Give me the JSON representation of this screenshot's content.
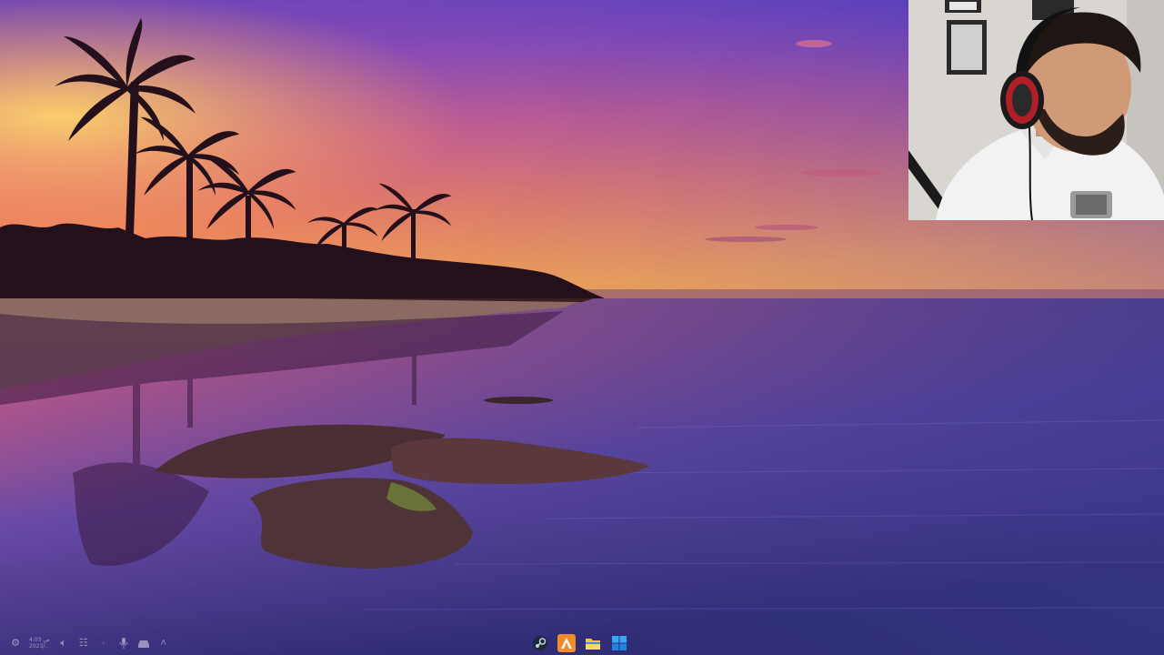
{
  "screen": {
    "description_icon": "desktop-wallpaper",
    "accent": "#d84a6a"
  },
  "taskbar": {
    "tray": {
      "clock_line1": "ص 4:03",
      "clock_line2": "2023/..",
      "icons": [
        "settings-icon",
        "volume-icon",
        "network-icon",
        "microphone-icon",
        "drive-icon",
        "chevron-up-icon"
      ]
    },
    "apps": [
      {
        "name": "steam-icon",
        "color": "#1b2838"
      },
      {
        "name": "arcade-icon",
        "color": "#f28c28"
      },
      {
        "name": "file-explorer-icon",
        "color": "#f5c242"
      },
      {
        "name": "windows-start-icon",
        "color": "#1e90ff"
      }
    ]
  }
}
